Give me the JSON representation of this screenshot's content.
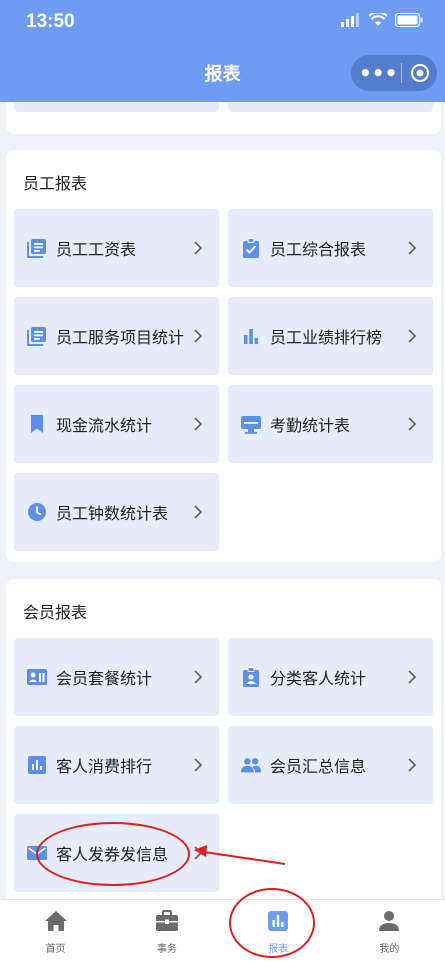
{
  "status": {
    "time": "13:50"
  },
  "nav": {
    "title": "报表"
  },
  "employee": {
    "title": "员工报表",
    "items": [
      {
        "label": "员工工资表",
        "icon": "list-icon"
      },
      {
        "label": "员工综合报表",
        "icon": "clipboard-check-icon"
      },
      {
        "label": "员工服务项目统计",
        "icon": "list-icon"
      },
      {
        "label": "员工业绩排行榜",
        "icon": "bar-chart-icon"
      },
      {
        "label": "现金流水统计",
        "icon": "bookmark-icon"
      },
      {
        "label": "考勤统计表",
        "icon": "monitor-icon"
      },
      {
        "label": "员工钟数统计表",
        "icon": "clock-icon"
      }
    ]
  },
  "member": {
    "title": "会员报表",
    "items": [
      {
        "label": "会员套餐统计",
        "icon": "id-card-icon"
      },
      {
        "label": "分类客人统计",
        "icon": "clipboard-user-icon"
      },
      {
        "label": "客人消费排行",
        "icon": "chart-box-icon"
      },
      {
        "label": "会员汇总信息",
        "icon": "people-icon"
      },
      {
        "label": "客人发券发信息",
        "icon": "mail-icon"
      }
    ]
  },
  "tabs": [
    {
      "label": "首页",
      "icon": "home-icon"
    },
    {
      "label": "事务",
      "icon": "briefcase-icon"
    },
    {
      "label": "报表",
      "icon": "report-icon",
      "active": true
    },
    {
      "label": "我的",
      "icon": "person-icon"
    }
  ],
  "colors": {
    "accent": "#6e9cf2",
    "card": "#e6ecf9",
    "highlight": "#e02020"
  }
}
